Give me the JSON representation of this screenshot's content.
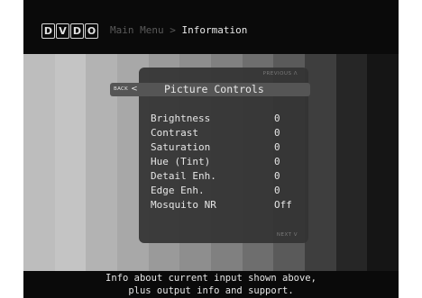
{
  "header": {
    "logo_letters": [
      "D",
      "V",
      "D",
      "O"
    ],
    "breadcrumb_parent": "Main Menu",
    "breadcrumb_separator": ">",
    "breadcrumb_current": "Information"
  },
  "panel": {
    "previous_label": "PREVIOUS",
    "previous_arrow": "Λ",
    "back_label": "BACK",
    "back_arrow": "<",
    "title": "Picture Controls",
    "next_label": "NEXT",
    "next_arrow": "V",
    "settings": [
      {
        "label": "Brightness",
        "value": "0"
      },
      {
        "label": "Contrast",
        "value": "0"
      },
      {
        "label": "Saturation",
        "value": "0"
      },
      {
        "label": "Hue  (Tint)",
        "value": "0"
      },
      {
        "label": "Detail Enh.",
        "value": "0"
      },
      {
        "label": "Edge Enh.",
        "value": "0"
      },
      {
        "label": "Mosquito NR",
        "value": "Off"
      }
    ]
  },
  "footer": {
    "line1": "Info about current input shown above,",
    "line2": "plus output info and support."
  },
  "test_pattern": {
    "bar_colors": [
      "#bdbdbd",
      "#c4c4c4",
      "#b3b3b3",
      "#a8a8a8",
      "#9a9a9a",
      "#8e8e8e",
      "#808080",
      "#6e6e6e",
      "#5a5a5a",
      "#3e3e3e",
      "#262626",
      "#151515"
    ]
  },
  "colors": {
    "screen_background": "#0a0a0a",
    "panel_background": "#343434",
    "title_bar": "#555555",
    "text": "#e6e6e6",
    "dim_text": "#5a5a5a"
  }
}
